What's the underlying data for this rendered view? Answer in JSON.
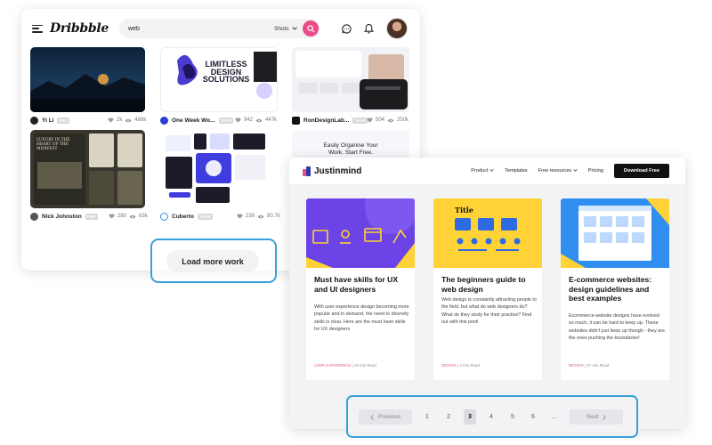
{
  "dribbble": {
    "logo": "Dribbble",
    "search_value": "web",
    "search_filter": "Shots",
    "shots": [
      {
        "author": "Yi Li",
        "tag": "PRO",
        "likes": "2k",
        "views": "488k"
      },
      {
        "author": "One Week Wo...",
        "tag": "TEAM",
        "likes": "942",
        "views": "447k",
        "art_line1": "LIMITLESS",
        "art_line2": "DESIGN",
        "art_line3": "SOLUTIONS"
      },
      {
        "author": "RonDesignLab...",
        "tag": "TEAM",
        "likes": "504",
        "views": "250k"
      },
      {
        "author": "Nick Johnston",
        "tag": "PRO",
        "likes": "280",
        "views": "63k",
        "art_text": "LUXURY IN THE HEART OF THE MIDWEST"
      },
      {
        "author": "Cuberto",
        "tag": "TEAM",
        "likes": "239",
        "views": "80.7k"
      },
      {
        "art_line1": "Easily Organise Your",
        "art_line2": "Work. Start Free."
      }
    ],
    "load_more_label": "Load more work"
  },
  "justinmind": {
    "logo": "Justinmind",
    "nav": {
      "product": "Product",
      "templates": "Templates",
      "free_resources": "Free resources",
      "pricing": "Pricing",
      "download": "Download Free"
    },
    "cards": [
      {
        "title": "Must have skills for UX and UI designers",
        "description": "With user experience design becoming more popular and in demand, the need to diversify skills is clear. Here are the must have skills for UX designers",
        "category": "USER EXPERIENCE",
        "read_time": "10 min Read"
      },
      {
        "title": "The beginners guide to web design",
        "art_label": "Title",
        "description": "Web design is constantly attracting people to the field, but what do web designers do? What do they study for their practice? Find out with this post!",
        "category": "DESIGN",
        "read_time": "3 min Read"
      },
      {
        "title": "E-commerce websites: design guidelines and best examples",
        "description": "Ecommerce website designs have evolved so much, it can be hard to keep up. These websites didn't just keep up though - they are the ones pushing the boundaries!",
        "category": "DESIGN",
        "read_time": "27 min Read"
      }
    ],
    "pagination": {
      "previous": "Previous",
      "next": "Next",
      "pages": [
        "1",
        "2",
        "3",
        "4",
        "5",
        "6",
        "..."
      ],
      "current": "3"
    }
  },
  "colors": {
    "dribbble_pink": "#ea4c89",
    "highlight_blue": "#3aa1d8",
    "jm_purple": "#6b43e6",
    "jm_yellow": "#ffd335",
    "jm_blue": "#2f8ef0"
  },
  "icons": [
    "menu-icon",
    "chevron-down-icon",
    "search-icon",
    "chat-icon",
    "bell-icon",
    "heart-icon",
    "eye-icon",
    "chevron-left-icon",
    "chevron-right-icon"
  ]
}
